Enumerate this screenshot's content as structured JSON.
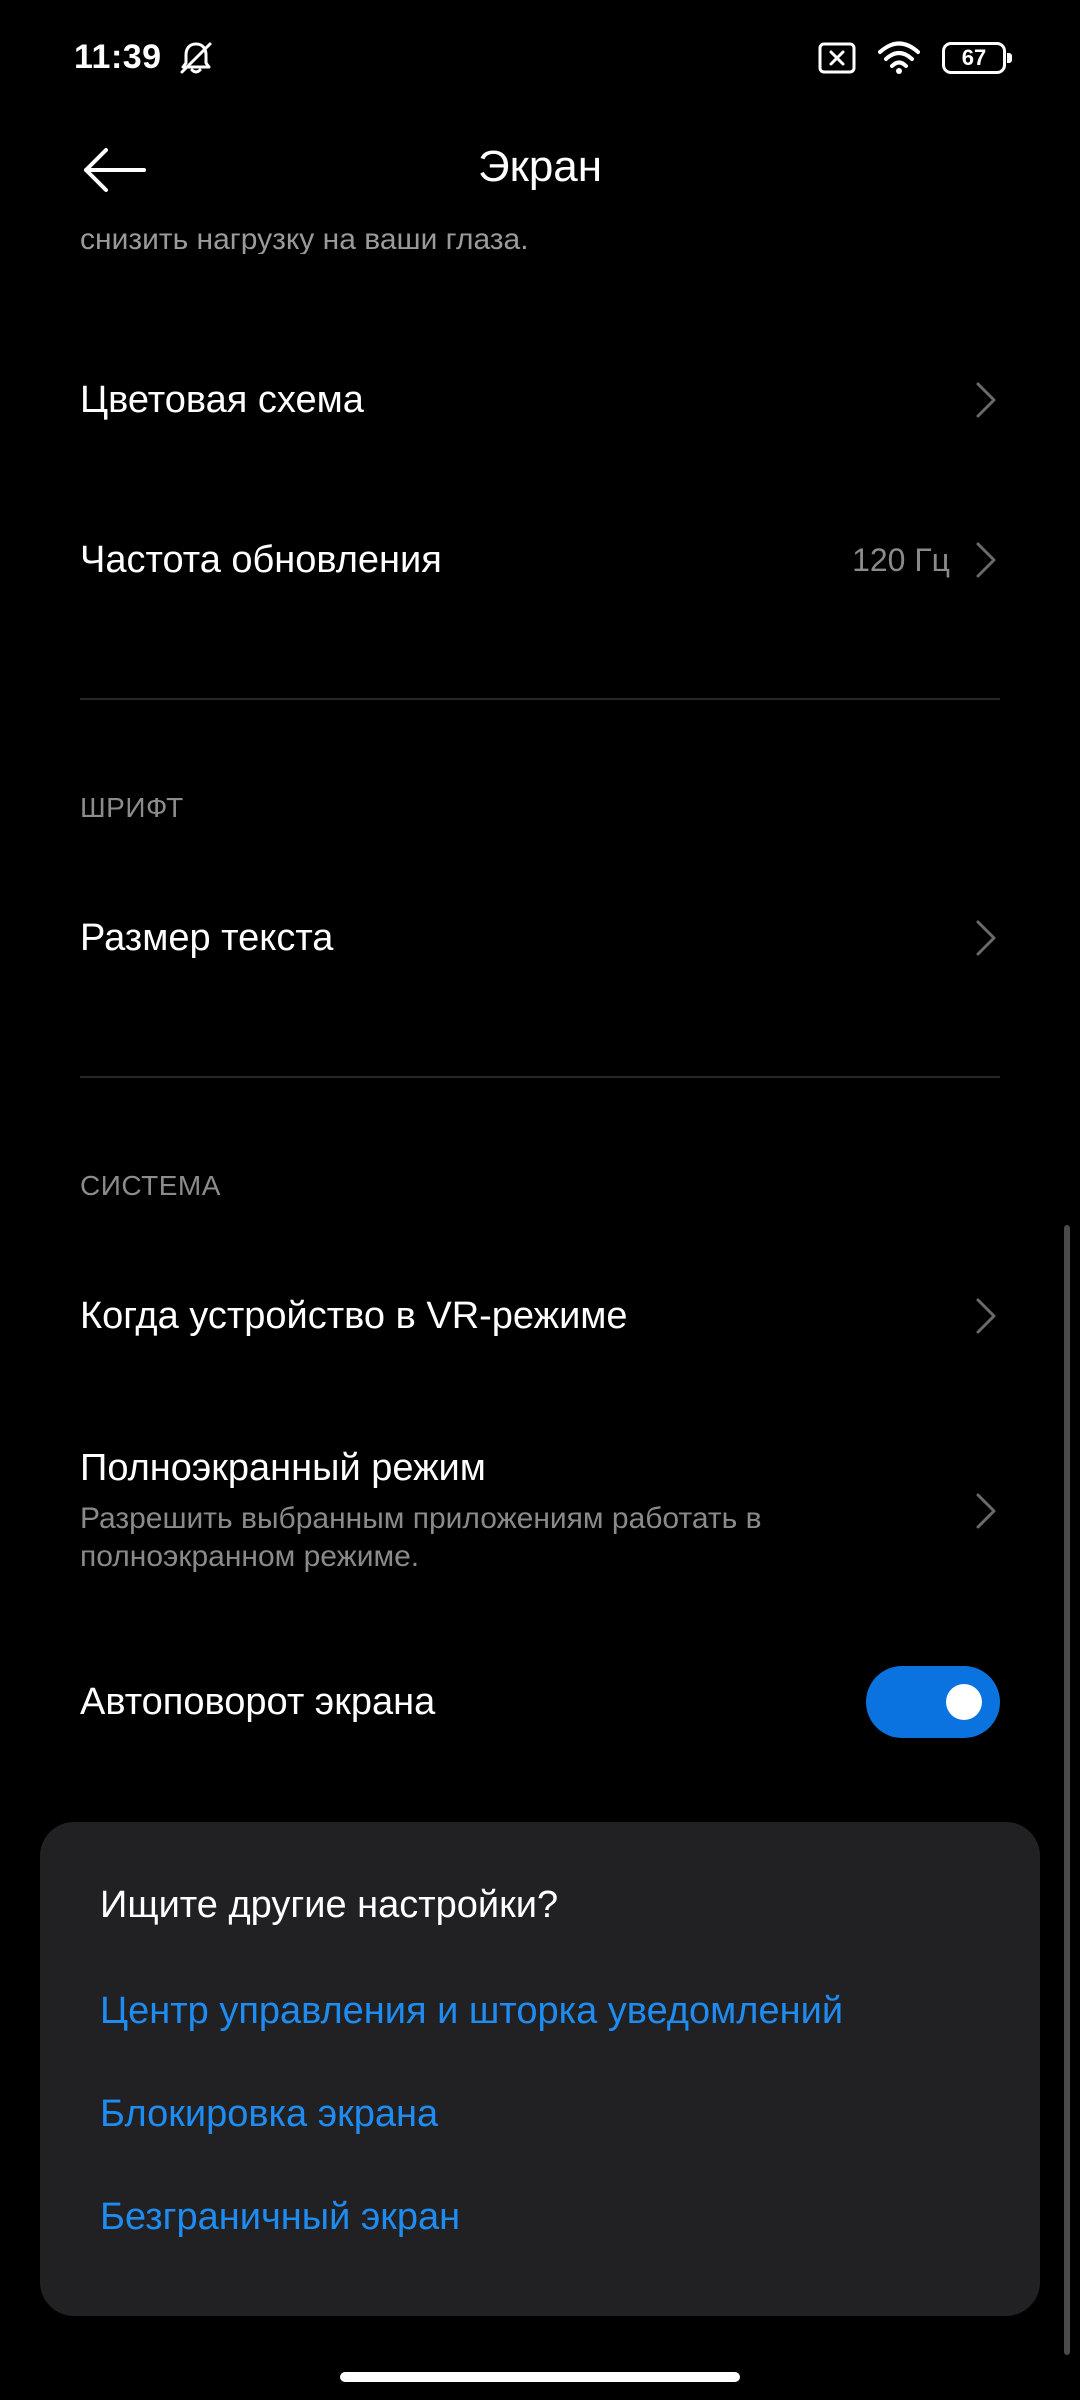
{
  "status_bar": {
    "time": "11:39",
    "battery_level": "67",
    "icons": [
      "bell-off-icon",
      "sim-x-icon",
      "wifi-icon",
      "battery-icon"
    ]
  },
  "header": {
    "title": "Экран",
    "back_icon": "arrow-left-icon"
  },
  "content": {
    "cut_text": "снизить нагрузку на ваши глаза.",
    "rows": {
      "color_scheme": {
        "label": "Цветовая схема"
      },
      "refresh_rate": {
        "label": "Частота обновления",
        "value": "120 Гц"
      },
      "text_size": {
        "label": "Размер текста"
      },
      "vr_mode": {
        "label": "Когда устройство в VR-режиме"
      },
      "fullscreen": {
        "label": "Полноэкранный режим",
        "subtitle": "Разрешить выбранным приложениям работать в полноэкранном режиме."
      },
      "auto_rotate": {
        "label": "Автоповорот экрана",
        "enabled": true
      }
    },
    "sections": {
      "font": "ШРИФТ",
      "system": "СИСТЕМА"
    }
  },
  "suggest_card": {
    "title": "Ищите другие настройки?",
    "links": [
      "Центр управления и шторка уведомлений",
      "Блокировка экрана",
      "Безграничный экран"
    ]
  },
  "colors": {
    "background": "#000000",
    "accent": "#1e8cf0",
    "toggle_on": "#0a73e0",
    "card": "#212124"
  }
}
